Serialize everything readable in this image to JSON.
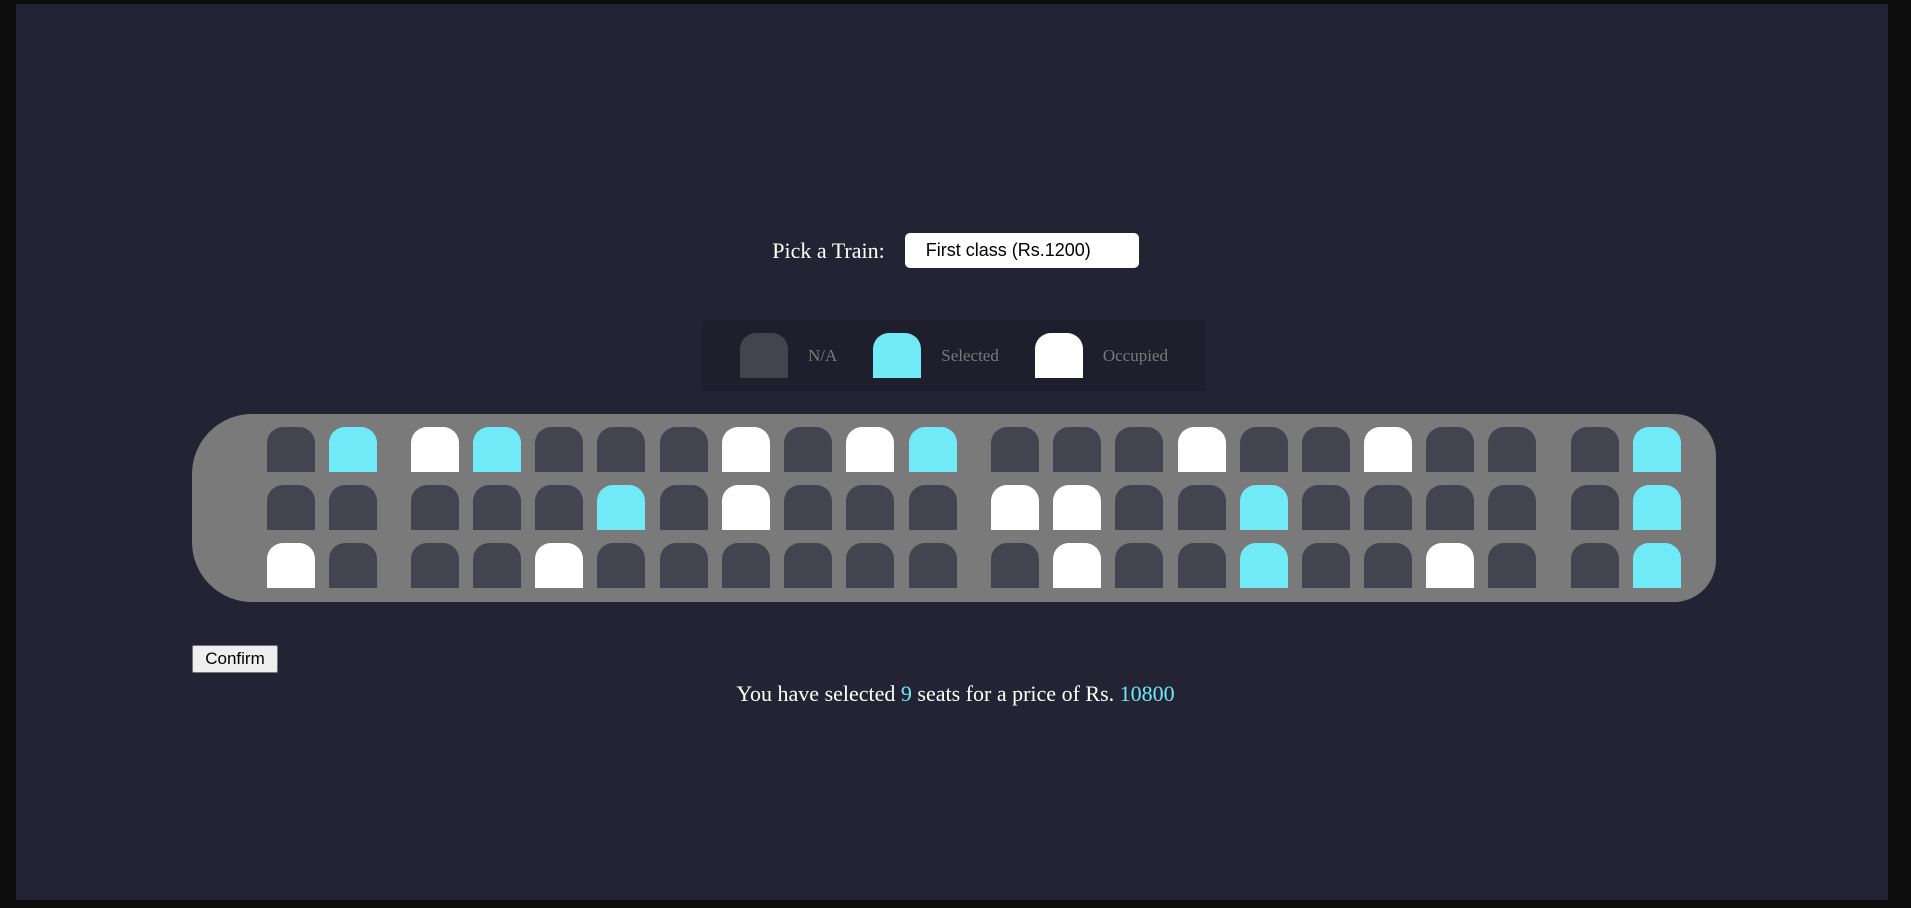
{
  "picker": {
    "label": "Pick a Train:",
    "selected": "First class (Rs.1200)"
  },
  "legend": [
    {
      "status": "na",
      "label": "N/A"
    },
    {
      "status": "selected",
      "label": "Selected"
    },
    {
      "status": "occupied",
      "label": "Occupied"
    }
  ],
  "seat_rows": [
    [
      "na",
      "selected",
      "occupied",
      "selected",
      "na",
      "na",
      "na",
      "occupied",
      "na",
      "occupied",
      "selected",
      "na",
      "na",
      "na",
      "occupied",
      "na",
      "na",
      "occupied",
      "na",
      "na",
      "na",
      "selected"
    ],
    [
      "na",
      "na",
      "na",
      "na",
      "na",
      "selected",
      "na",
      "occupied",
      "na",
      "na",
      "na",
      "occupied",
      "occupied",
      "na",
      "na",
      "selected",
      "na",
      "na",
      "na",
      "na",
      "na",
      "selected"
    ],
    [
      "occupied",
      "na",
      "na",
      "na",
      "occupied",
      "na",
      "na",
      "na",
      "na",
      "na",
      "na",
      "na",
      "occupied",
      "na",
      "na",
      "selected",
      "na",
      "na",
      "occupied",
      "na",
      "na",
      "selected"
    ]
  ],
  "confirm_label": "Confirm",
  "summary": {
    "prefix": "You have selected",
    "count": "9",
    "middle": "seats for a price of Rs.",
    "price": "10800"
  },
  "colors": {
    "background": "#242333",
    "na": "#444451",
    "selected": "#6feaf6",
    "occupied": "#ffffff",
    "train": "#7a7a7a"
  }
}
